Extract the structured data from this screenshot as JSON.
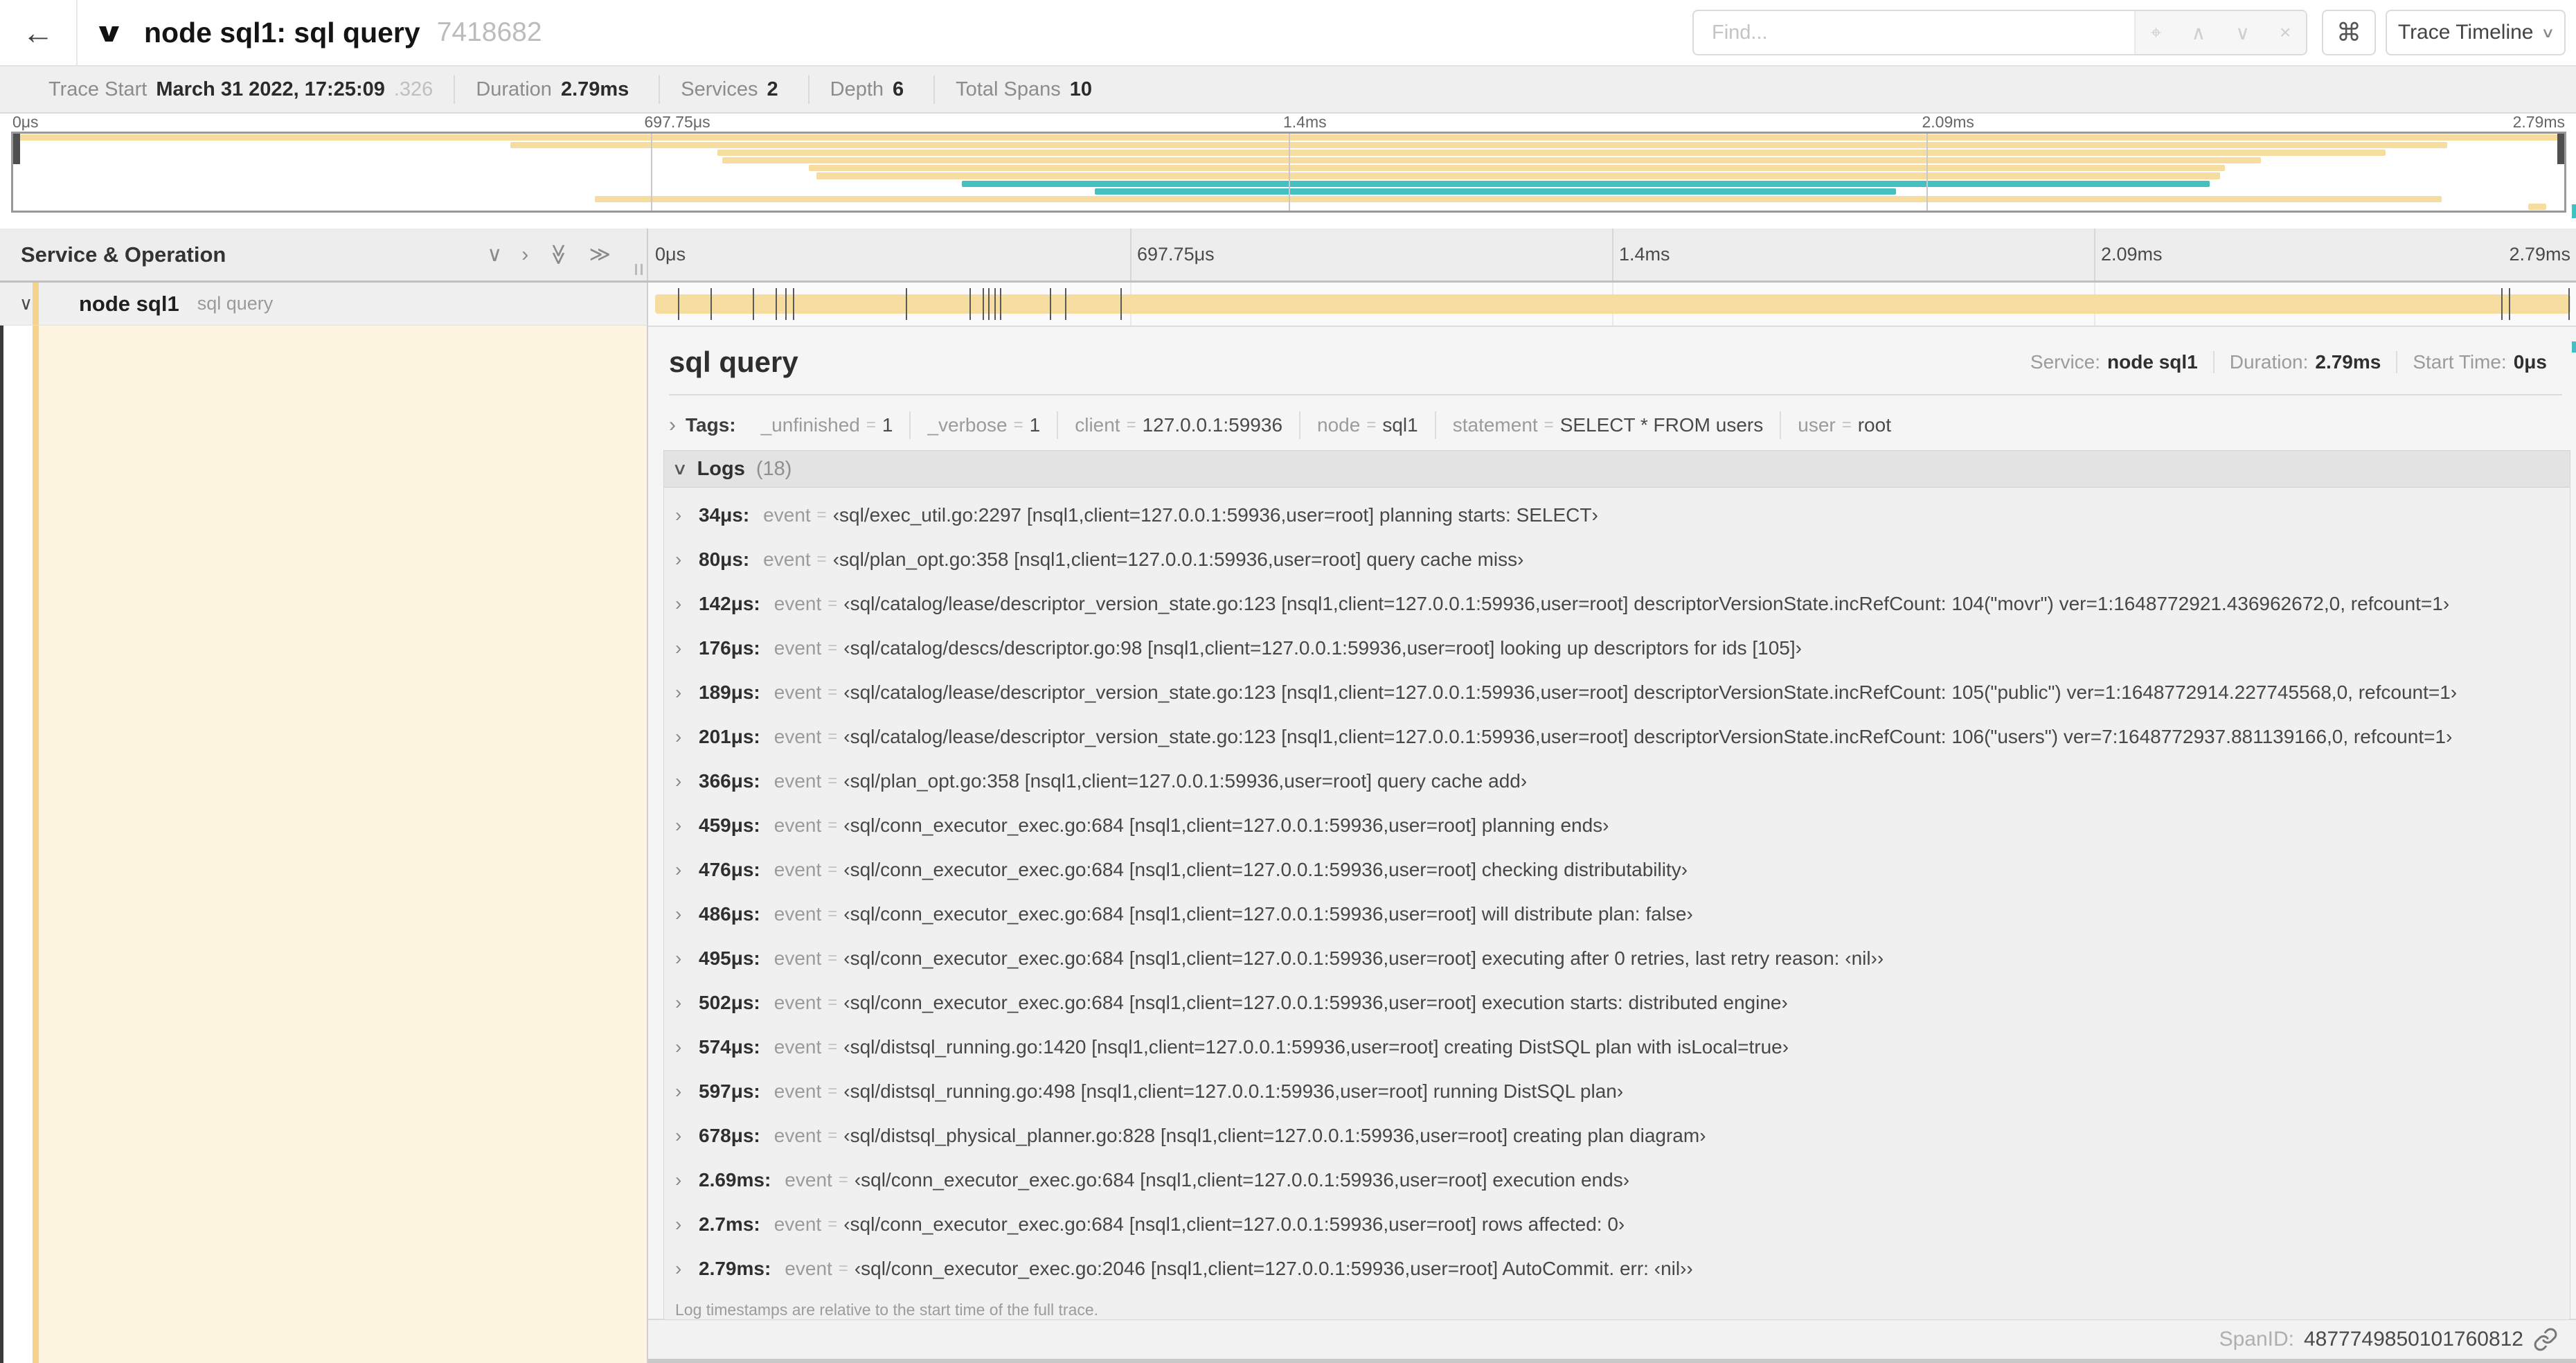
{
  "colors": {
    "span_tan": "#F7DCA0",
    "span_teal": "#44C0C0",
    "stripe_tan": "#F5D38C",
    "detail_cream": "#FDF4DF"
  },
  "header": {
    "back_icon": "←",
    "collapse_chevron": "∨",
    "title": "node sql1: sql query",
    "trace_id_short": "7418682",
    "find": {
      "placeholder": "Find...",
      "icons": [
        "⌖",
        "∧",
        "∨",
        "×"
      ]
    },
    "shortcut_button": "⌘",
    "view_selector": {
      "label": "Trace Timeline",
      "chevron": "∨"
    }
  },
  "summary_bar": {
    "items": [
      {
        "label": "Trace Start",
        "value": "March 31 2022, 17:25:09",
        "suffix": ".326"
      },
      {
        "label": "Duration",
        "value": "2.79ms",
        "suffix": ""
      },
      {
        "label": "Services",
        "value": "2",
        "suffix": ""
      },
      {
        "label": "Depth",
        "value": "6",
        "suffix": ""
      },
      {
        "label": "Total Spans",
        "value": "10",
        "suffix": ""
      }
    ]
  },
  "minimap": {
    "ticks": [
      {
        "label": "0μs",
        "pos": 0
      },
      {
        "label": "697.75μs",
        "pos": 25
      },
      {
        "label": "1.4ms",
        "pos": 50
      },
      {
        "label": "2.09ms",
        "pos": 75
      },
      {
        "label": "2.79ms",
        "pos": 100
      }
    ],
    "spans": [
      {
        "start": 0,
        "end": 100,
        "color": "tan"
      },
      {
        "start": 19.5,
        "end": 95.4,
        "color": "tan"
      },
      {
        "start": 27.6,
        "end": 93.0,
        "color": "tan"
      },
      {
        "start": 27.8,
        "end": 88.1,
        "color": "tan"
      },
      {
        "start": 31.2,
        "end": 86.7,
        "color": "tan"
      },
      {
        "start": 31.5,
        "end": 86.5,
        "color": "tan"
      },
      {
        "start": 37.2,
        "end": 86.1,
        "color": "teal"
      },
      {
        "start": 42.4,
        "end": 73.8,
        "color": "teal"
      },
      {
        "start": 22.8,
        "end": 95.2,
        "color": "tan"
      },
      {
        "start": 98.6,
        "end": 99.3,
        "color": "tan"
      }
    ]
  },
  "timeline": {
    "left_header": "Service & Operation",
    "header_icons": [
      {
        "name": "collapse-one-icon",
        "glyph": "∨",
        "rotate": false
      },
      {
        "name": "expand-one-icon",
        "glyph": "›",
        "rotate": false
      },
      {
        "name": "collapse-all-icon",
        "glyph": "≫",
        "rotate": true
      },
      {
        "name": "expand-all-icon",
        "glyph": "≫",
        "rotate": false
      }
    ],
    "ticks": [
      {
        "label": "0μs",
        "pos": 0
      },
      {
        "label": "697.75μs",
        "pos": 25
      },
      {
        "label": "1.4ms",
        "pos": 50
      },
      {
        "label": "2.09ms",
        "pos": 75
      },
      {
        "label": "2.79ms",
        "pos": 100
      }
    ],
    "row": {
      "chevron": "∨",
      "service": "node sql1",
      "operation": "sql query"
    },
    "log_markers_pct": [
      1.2,
      2.9,
      5.1,
      6.3,
      6.8,
      7.2,
      13.1,
      16.4,
      17.1,
      17.4,
      17.7,
      18.0,
      20.6,
      21.4,
      24.3,
      96.4,
      96.8,
      99.9
    ]
  },
  "detail": {
    "operation_title": "sql query",
    "meta": [
      {
        "label": "Service:",
        "value": "node sql1"
      },
      {
        "label": "Duration:",
        "value": "2.79ms"
      },
      {
        "label": "Start Time:",
        "value": "0μs"
      }
    ],
    "tags_chevron": "›",
    "tags_label": "Tags:",
    "tags": [
      {
        "key": "_unfinished",
        "value": "1"
      },
      {
        "key": "_verbose",
        "value": "1"
      },
      {
        "key": "client",
        "value": "127.0.0.1:59936"
      },
      {
        "key": "node",
        "value": "sql1"
      },
      {
        "key": "statement",
        "value": "SELECT * FROM users"
      },
      {
        "key": "user",
        "value": "root"
      }
    ],
    "logs_chevron": "∨",
    "logs_label": "Logs",
    "logs_count": "(18)",
    "log_key": "event",
    "logs": [
      {
        "time": "34μs:",
        "value": "‹sql/exec_util.go:2297 [nsql1,client=127.0.0.1:59936,user=root] planning starts: SELECT›"
      },
      {
        "time": "80μs:",
        "value": "‹sql/plan_opt.go:358 [nsql1,client=127.0.0.1:59936,user=root] query cache miss›"
      },
      {
        "time": "142μs:",
        "value": "‹sql/catalog/lease/descriptor_version_state.go:123 [nsql1,client=127.0.0.1:59936,user=root] descriptorVersionState.incRefCount: 104(\"movr\") ver=1:1648772921.436962672,0, refcount=1›"
      },
      {
        "time": "176μs:",
        "value": "‹sql/catalog/descs/descriptor.go:98 [nsql1,client=127.0.0.1:59936,user=root] looking up descriptors for ids [105]›"
      },
      {
        "time": "189μs:",
        "value": "‹sql/catalog/lease/descriptor_version_state.go:123 [nsql1,client=127.0.0.1:59936,user=root] descriptorVersionState.incRefCount: 105(\"public\") ver=1:1648772914.227745568,0, refcount=1›"
      },
      {
        "time": "201μs:",
        "value": "‹sql/catalog/lease/descriptor_version_state.go:123 [nsql1,client=127.0.0.1:59936,user=root] descriptorVersionState.incRefCount: 106(\"users\") ver=7:1648772937.881139166,0, refcount=1›"
      },
      {
        "time": "366μs:",
        "value": "‹sql/plan_opt.go:358 [nsql1,client=127.0.0.1:59936,user=root] query cache add›"
      },
      {
        "time": "459μs:",
        "value": "‹sql/conn_executor_exec.go:684 [nsql1,client=127.0.0.1:59936,user=root] planning ends›"
      },
      {
        "time": "476μs:",
        "value": "‹sql/conn_executor_exec.go:684 [nsql1,client=127.0.0.1:59936,user=root] checking distributability›"
      },
      {
        "time": "486μs:",
        "value": "‹sql/conn_executor_exec.go:684 [nsql1,client=127.0.0.1:59936,user=root] will distribute plan: false›"
      },
      {
        "time": "495μs:",
        "value": "‹sql/conn_executor_exec.go:684 [nsql1,client=127.0.0.1:59936,user=root] executing after 0 retries, last retry reason: ‹nil››"
      },
      {
        "time": "502μs:",
        "value": "‹sql/conn_executor_exec.go:684 [nsql1,client=127.0.0.1:59936,user=root] execution starts: distributed engine›"
      },
      {
        "time": "574μs:",
        "value": "‹sql/distsql_running.go:1420 [nsql1,client=127.0.0.1:59936,user=root] creating DistSQL plan with isLocal=true›"
      },
      {
        "time": "597μs:",
        "value": "‹sql/distsql_running.go:498 [nsql1,client=127.0.0.1:59936,user=root] running DistSQL plan›"
      },
      {
        "time": "678μs:",
        "value": "‹sql/distsql_physical_planner.go:828 [nsql1,client=127.0.0.1:59936,user=root] creating plan diagram›"
      },
      {
        "time": "2.69ms:",
        "value": "‹sql/conn_executor_exec.go:684 [nsql1,client=127.0.0.1:59936,user=root] execution ends›"
      },
      {
        "time": "2.7ms:",
        "value": "‹sql/conn_executor_exec.go:684 [nsql1,client=127.0.0.1:59936,user=root] rows affected: 0›"
      },
      {
        "time": "2.79ms:",
        "value": "‹sql/conn_executor_exec.go:2046 [nsql1,client=127.0.0.1:59936,user=root] AutoCommit. err: ‹nil››"
      }
    ],
    "logs_footer": "Log timestamps are relative to the start time of the full trace.",
    "span_id_label": "SpanID:",
    "span_id": "4877749850101760812"
  }
}
